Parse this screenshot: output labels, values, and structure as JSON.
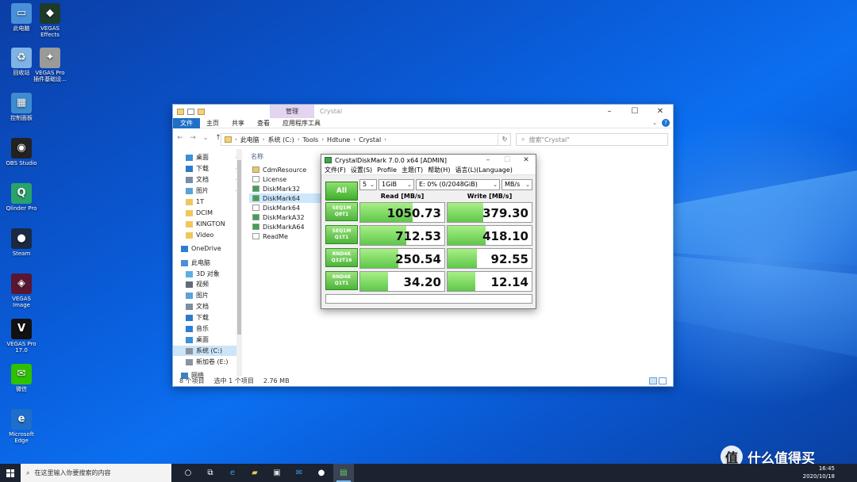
{
  "desktop": {
    "icons": [
      {
        "label": "此电脑",
        "icon": "computer-icon",
        "color": "#4a90d9"
      },
      {
        "label": "VEGAS Effects",
        "icon": "vegas-effects-icon",
        "color": "#1e3a2a"
      },
      {
        "label": "回收站",
        "icon": "recycle-bin-icon",
        "color": "#7fb2e5"
      },
      {
        "label": "VEGAS Pro 插件基础设...",
        "icon": "vegas-plugin-icon",
        "color": "#9a9a9a"
      },
      {
        "label": "控制面板",
        "icon": "control-panel-icon",
        "color": "#3f8bd0"
      },
      {
        "label": "OBS Studio",
        "icon": "obs-icon",
        "color": "#222222"
      },
      {
        "label": "Qlinder Pro",
        "icon": "qlinder-icon",
        "color": "#2aa36b"
      },
      {
        "label": "Steam",
        "icon": "steam-icon",
        "color": "#1a2a44"
      },
      {
        "label": "VEGAS Image",
        "icon": "vegas-image-icon",
        "color": "#5a1530"
      },
      {
        "label": "VEGAS Pro 17.0",
        "icon": "vegas-pro-icon",
        "color": "#111111"
      },
      {
        "label": "微信",
        "icon": "wechat-icon",
        "color": "#2dc100"
      },
      {
        "label": "Microsoft Edge",
        "icon": "edge-icon",
        "color": "#1e6fc9"
      }
    ]
  },
  "explorer": {
    "title": "Crystal",
    "manage_tab": "管理",
    "ribbon_tabs": [
      "文件",
      "主页",
      "共享",
      "查看",
      "应用程序工具"
    ],
    "address": [
      "此电脑",
      "系统 (C:)",
      "Tools",
      "Hdtune",
      "Crystal"
    ],
    "search_placeholder": "搜索\"Crystal\"",
    "sidebar": [
      {
        "label": "桌面",
        "icon": "desktop-folder-icon",
        "pinned": true
      },
      {
        "label": "下载",
        "icon": "download-icon",
        "pinned": true
      },
      {
        "label": "文档",
        "icon": "documents-icon",
        "pinned": true
      },
      {
        "label": "图片",
        "icon": "pictures-icon",
        "pinned": true
      },
      {
        "label": "1T",
        "icon": "folder-icon",
        "pinned": false
      },
      {
        "label": "DCIM",
        "icon": "folder-icon",
        "pinned": false
      },
      {
        "label": "KINGTON",
        "icon": "folder-icon",
        "pinned": false
      },
      {
        "label": "Video",
        "icon": "folder-icon",
        "pinned": false
      },
      {
        "label": "OneDrive",
        "icon": "onedrive-icon",
        "pinned": false
      },
      {
        "label": "此电脑",
        "icon": "computer-icon",
        "pinned": false
      },
      {
        "label": "3D 对象",
        "icon": "3d-objects-icon",
        "pinned": false
      },
      {
        "label": "视频",
        "icon": "videos-icon",
        "pinned": false
      },
      {
        "label": "图片",
        "icon": "pictures-icon",
        "pinned": false
      },
      {
        "label": "文档",
        "icon": "documents-icon",
        "pinned": false
      },
      {
        "label": "下载",
        "icon": "download-icon",
        "pinned": false
      },
      {
        "label": "音乐",
        "icon": "music-icon",
        "pinned": false
      },
      {
        "label": "桌面",
        "icon": "desktop-folder-icon",
        "pinned": false
      },
      {
        "label": "系统 (C:)",
        "icon": "drive-icon",
        "pinned": false
      },
      {
        "label": "新加卷 (E:)",
        "icon": "drive-icon",
        "pinned": false
      },
      {
        "label": "网络",
        "icon": "network-icon",
        "pinned": false
      }
    ],
    "column_header": "名称",
    "files": [
      {
        "name": "CdmResource",
        "icon": "folder-icon"
      },
      {
        "name": "License",
        "icon": "text-file-icon"
      },
      {
        "name": "DiskMark32",
        "icon": "app-icon"
      },
      {
        "name": "DiskMark64",
        "icon": "app-icon"
      },
      {
        "name": "DiskMark64",
        "icon": "text-file-icon"
      },
      {
        "name": "DiskMarkA32",
        "icon": "app-icon"
      },
      {
        "name": "DiskMarkA64",
        "icon": "app-icon"
      },
      {
        "name": "ReadMe",
        "icon": "text-file-icon"
      }
    ],
    "status": {
      "count": "8 个项目",
      "selected": "选中 1 个项目",
      "size": "2.76 MB"
    }
  },
  "cdm": {
    "title": "CrystalDiskMark 7.0.0 x64 [ADMIN]",
    "menu": [
      "文件(F)",
      "设置(S)",
      "Profile",
      "主题(T)",
      "帮助(H)",
      "语言(L)(Language)"
    ],
    "all_button": "All",
    "count": "5",
    "size": "1GiB",
    "drive": "E: 0% (0/2048GiB)",
    "unit": "MB/s",
    "read_header": "Read [MB/s]",
    "write_header": "Write [MB/s]",
    "accent": "#4cb43a",
    "rows": [
      {
        "label1": "SEQ1M",
        "label2": "Q8T1",
        "read": "1050.73",
        "write": "379.30",
        "read_fill": 0.62,
        "write_fill": 0.42
      },
      {
        "label1": "SEQ1M",
        "label2": "Q1T1",
        "read": "712.53",
        "write": "418.10",
        "read_fill": 0.55,
        "write_fill": 0.45
      },
      {
        "label1": "RND4K",
        "label2": "Q32T16",
        "read": "250.54",
        "write": "92.55",
        "read_fill": 0.45,
        "write_fill": 0.35
      },
      {
        "label1": "RND4K",
        "label2": "Q1T1",
        "read": "34.20",
        "write": "12.14",
        "read_fill": 0.33,
        "write_fill": 0.33
      }
    ]
  },
  "taskbar": {
    "search_placeholder": "在这里输入你要搜索的内容",
    "icons": [
      "task-view-icon",
      "taskview-alt-icon",
      "edge-icon",
      "file-explorer-icon",
      "store-icon",
      "mail-icon",
      "steam-icon",
      "crystaldiskmark-icon"
    ],
    "time": "16:45",
    "date": "2020/10/18"
  },
  "watermark": {
    "badge": "值",
    "text": "什么值得买"
  }
}
